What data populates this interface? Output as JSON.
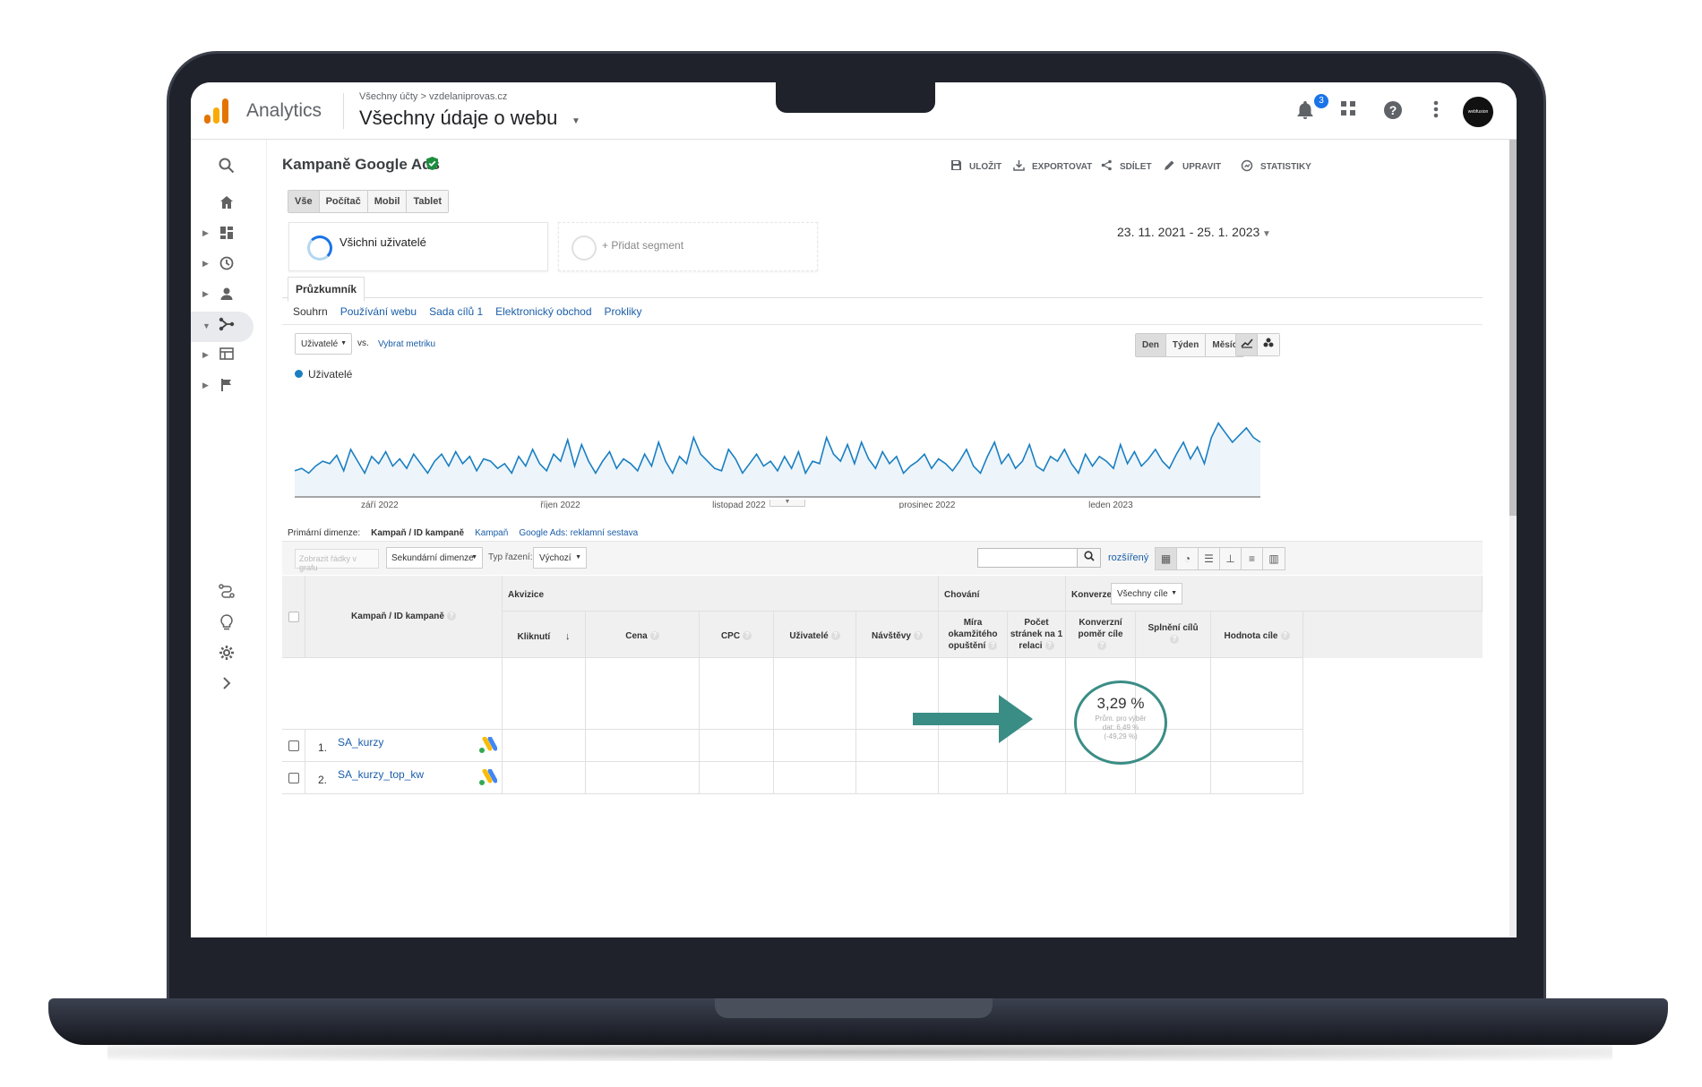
{
  "app": {
    "name": "Analytics",
    "breadcrumb": [
      "Všechny účty",
      "vzdelaniprovas.cz"
    ],
    "breadcrumb_sep": ">",
    "view_title": "Všechny údaje o webu",
    "notification_count": "3",
    "avatar_text": "webfusion"
  },
  "report": {
    "title": "Kampaně Google Ads",
    "actions": [
      {
        "label": "ULOŽIT",
        "icon": "save-icon"
      },
      {
        "label": "EXPORTOVAT",
        "icon": "export-icon"
      },
      {
        "label": "SDÍLET",
        "icon": "share-icon"
      },
      {
        "label": "UPRAVIT",
        "icon": "edit-icon"
      },
      {
        "label": "STATISTIKY",
        "icon": "insights-icon"
      }
    ]
  },
  "device_tabs": [
    "Vše",
    "Počítač",
    "Mobil",
    "Tablet"
  ],
  "device_tab_active": 0,
  "segments": {
    "active": "Všichni uživatelé",
    "add": "+ Přidat segment"
  },
  "date_range": "23. 11. 2021 - 25. 1. 2023",
  "explorer": {
    "tab": "Průzkumník",
    "subtabs": [
      "Souhrn",
      "Používání webu",
      "Sada cílů 1",
      "Elektronický obchod",
      "Prokliky"
    ]
  },
  "chart_controls": {
    "metric": "Uživatelé",
    "vs": "vs.",
    "choose_metric": "Vybrat metriku",
    "periods": [
      "Den",
      "Týden",
      "Měsíc"
    ],
    "period_active": 0
  },
  "chart_data": {
    "type": "area",
    "series": [
      {
        "name": "Uživatelé",
        "color": "#1a7fc2"
      }
    ],
    "x_ticks": [
      "září 2022",
      "říjen 2022",
      "listopad 2022",
      "prosinec 2022",
      "leden 2023"
    ],
    "values": [
      22,
      24,
      20,
      26,
      30,
      28,
      35,
      22,
      40,
      30,
      20,
      34,
      28,
      38,
      26,
      32,
      24,
      36,
      28,
      20,
      30,
      36,
      26,
      38,
      28,
      34,
      22,
      32,
      30,
      24,
      28,
      20,
      34,
      26,
      40,
      28,
      22,
      36,
      30,
      48,
      26,
      44,
      30,
      20,
      30,
      38,
      24,
      32,
      28,
      22,
      36,
      26,
      46,
      30,
      20,
      34,
      28,
      50,
      36,
      30,
      24,
      22,
      40,
      32,
      20,
      28,
      36,
      26,
      30,
      22,
      34,
      24,
      38,
      20,
      30,
      28,
      50,
      36,
      30,
      44,
      28,
      46,
      32,
      24,
      38,
      28,
      34,
      20,
      26,
      30,
      36,
      24,
      32,
      28,
      22,
      30,
      40,
      26,
      20,
      34,
      46,
      28,
      36,
      24,
      30,
      44,
      26,
      22,
      34,
      30,
      40,
      28,
      20,
      36,
      26,
      34,
      30,
      24,
      44,
      28,
      38,
      26,
      32,
      40,
      30,
      24,
      36,
      46,
      32,
      42,
      28,
      50,
      62,
      54,
      46,
      52,
      58,
      50,
      46
    ]
  },
  "table": {
    "primary_dimension_label": "Primární dimenze:",
    "primary_dimensions": [
      "Kampaň / ID kampaně",
      "Kampaň",
      "Google Ads: reklamní sestava"
    ],
    "plot_rows": "Zobrazit řádky v grafu",
    "secondary_dimension": "Sekundární dimenze",
    "sort_type_label": "Typ řazení:",
    "sort_type": "Výchozí",
    "advanced": "rozšířený",
    "groups": {
      "acquisition": "Akvizice",
      "behavior": "Chování",
      "conversions": "Konverze"
    },
    "goal_select": "Všechny cíle",
    "columns": {
      "campaign": "Kampaň / ID kampaně",
      "clicks": "Kliknutí",
      "cost": "Cena",
      "cpc": "CPC",
      "users": "Uživatelé",
      "sessions": "Návštěvy",
      "bounce": [
        "Míra",
        "okamžitého",
        "opuštění"
      ],
      "pages": [
        "Počet",
        "stránek na 1",
        "relaci"
      ],
      "conv_rate": [
        "Konverzní",
        "poměr cíle"
      ],
      "completions": "Splnění cílů",
      "goal_value": "Hodnota cíle"
    },
    "totals": {
      "conv_rate": "3,29 %",
      "conv_rate_sub": [
        "Prům. pro výběr",
        "dat: 6,49 %",
        "(-49,29 %)"
      ]
    },
    "rows": [
      {
        "num": "1.",
        "campaign": "SA_kurzy"
      },
      {
        "num": "2.",
        "campaign": "SA_kurzy_top_kw"
      }
    ]
  },
  "colors": {
    "accent_blue": "#1a73e8",
    "link_blue": "#1a5ea8",
    "series_blue": "#1a7fc2",
    "highlight_teal": "#3a8d85",
    "verified_green": "#1e8e3e"
  }
}
